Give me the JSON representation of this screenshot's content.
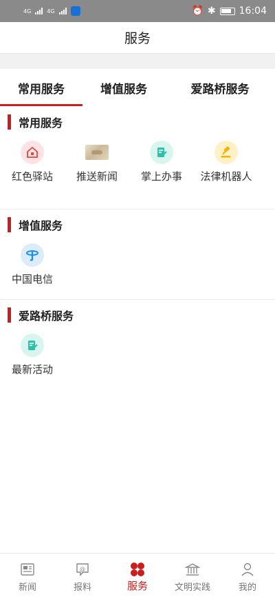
{
  "status_bar": {
    "network_1": "4G",
    "network_2": "4G",
    "time": "16:04"
  },
  "header": {
    "title": "服务"
  },
  "tabs": [
    {
      "label": "常用服务",
      "active": true
    },
    {
      "label": "增值服务",
      "active": false
    },
    {
      "label": "爱路桥服务",
      "active": false
    }
  ],
  "sections": {
    "common": {
      "title": "常用服务",
      "items": [
        {
          "label": "红色驿站",
          "icon": "flag-home-icon"
        },
        {
          "label": "推送新闻",
          "icon": "news-photo-icon"
        },
        {
          "label": "掌上办事",
          "icon": "edit-document-icon"
        },
        {
          "label": "法律机器人",
          "icon": "gavel-icon"
        }
      ]
    },
    "value_added": {
      "title": "增值服务",
      "items": [
        {
          "label": "中国电信",
          "icon": "china-telecom-icon"
        }
      ]
    },
    "luqiao": {
      "title": "爱路桥服务",
      "items": [
        {
          "label": "最新活动",
          "icon": "edit-document-icon"
        }
      ]
    }
  },
  "bottom_nav": [
    {
      "label": "新闻",
      "icon": "newspaper-icon",
      "active": false
    },
    {
      "label": "报料",
      "icon": "report-icon",
      "active": false
    },
    {
      "label": "服务",
      "icon": "service-icon",
      "active": true
    },
    {
      "label": "文明实践",
      "icon": "building-icon",
      "active": false
    },
    {
      "label": "我的",
      "icon": "user-icon",
      "active": false
    }
  ],
  "colors": {
    "accent": "#c81e1e",
    "status_bar": "#8a8a8a"
  }
}
